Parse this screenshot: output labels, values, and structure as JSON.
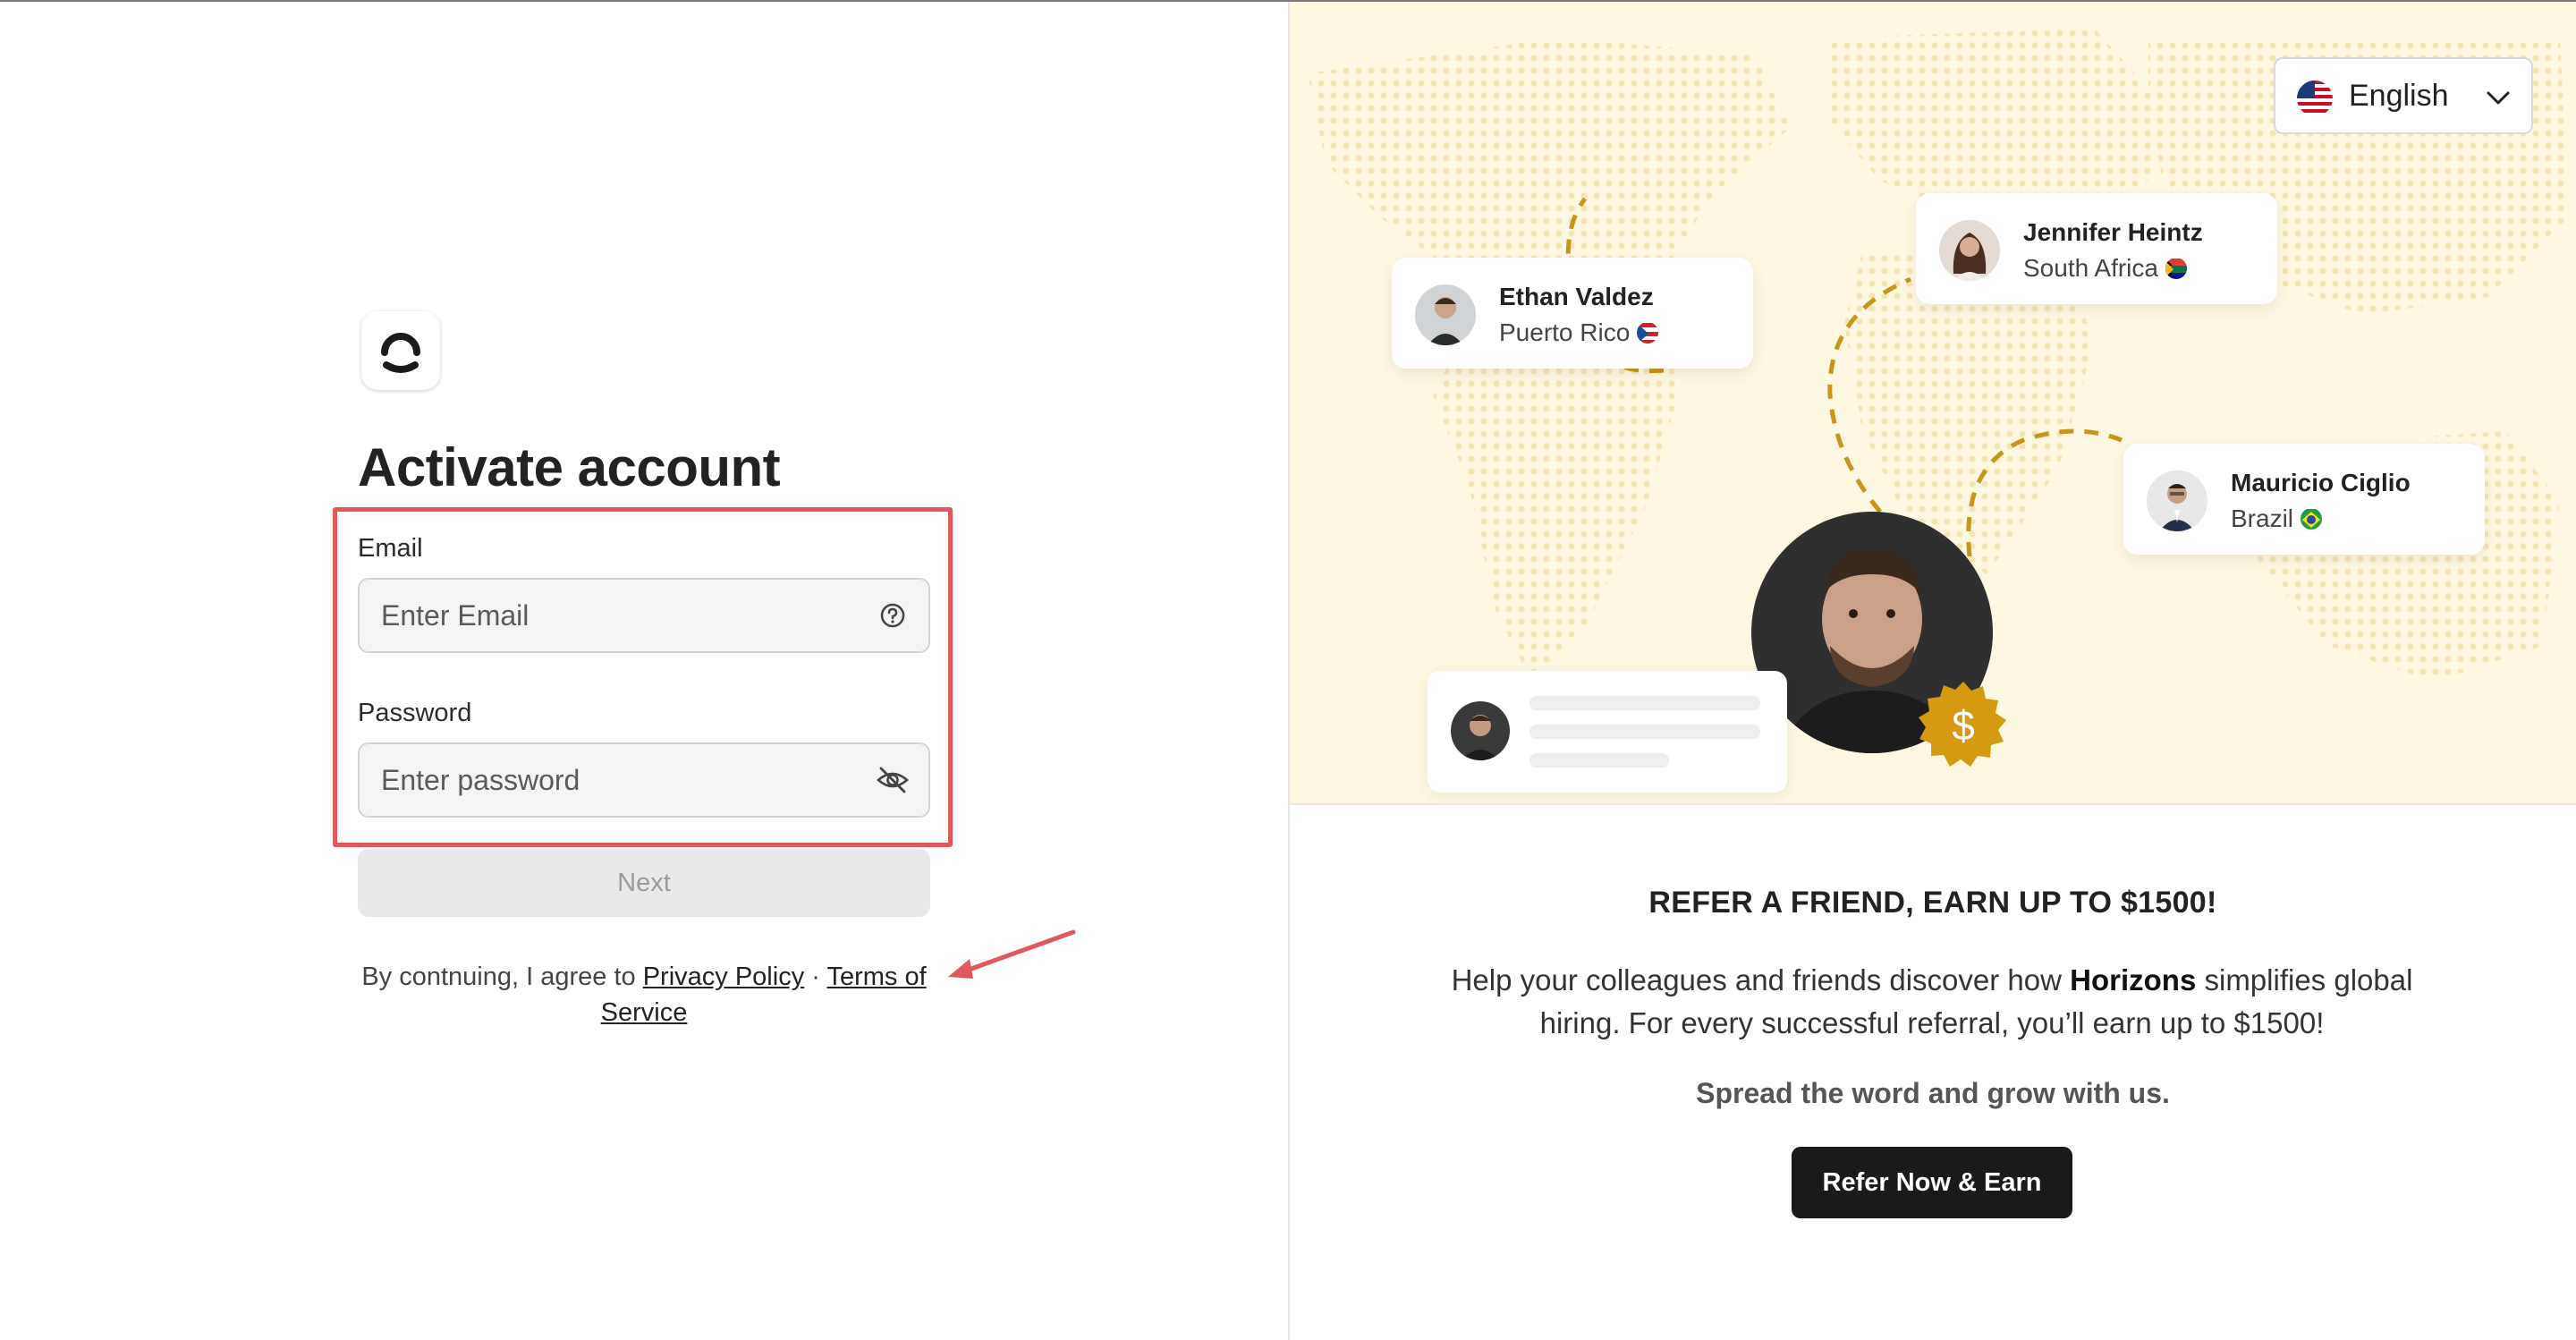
{
  "login": {
    "title": "Activate account",
    "email_label": "Email",
    "email_placeholder": "Enter Email",
    "password_label": "Password",
    "password_placeholder": "Enter password",
    "next_label": "Next",
    "agree_prefix": "By contnuing, I agree to",
    "privacy_link": "Privacy Policy",
    "separator": "·",
    "terms_link": "Terms of Service"
  },
  "language": {
    "selected": "English",
    "icon": "chevron-down-icon"
  },
  "people": [
    {
      "name": "Ethan Valdez",
      "location": "Puerto Rico"
    },
    {
      "name": "Jennifer Heintz",
      "location": "South Africa"
    },
    {
      "name": "Mauricio Ciglio",
      "location": "Brazil"
    }
  ],
  "badge_symbol": "$",
  "referral": {
    "title": "REFER A FRIEND, EARN UP TO $1500!",
    "body_before": "Help your colleagues and friends discover how",
    "brand": "Horizons",
    "body_after": "simplifies global hiring. For every successful referral, you’ll earn up to $1500!",
    "tagline": "Spread the word and grow with us.",
    "cta": "Refer Now & Earn"
  },
  "colors": {
    "accent_gold": "#d59a12",
    "highlight_red": "#e2575a",
    "hero_bg": "#fef8e2",
    "button_dark": "#1a1a1a"
  }
}
